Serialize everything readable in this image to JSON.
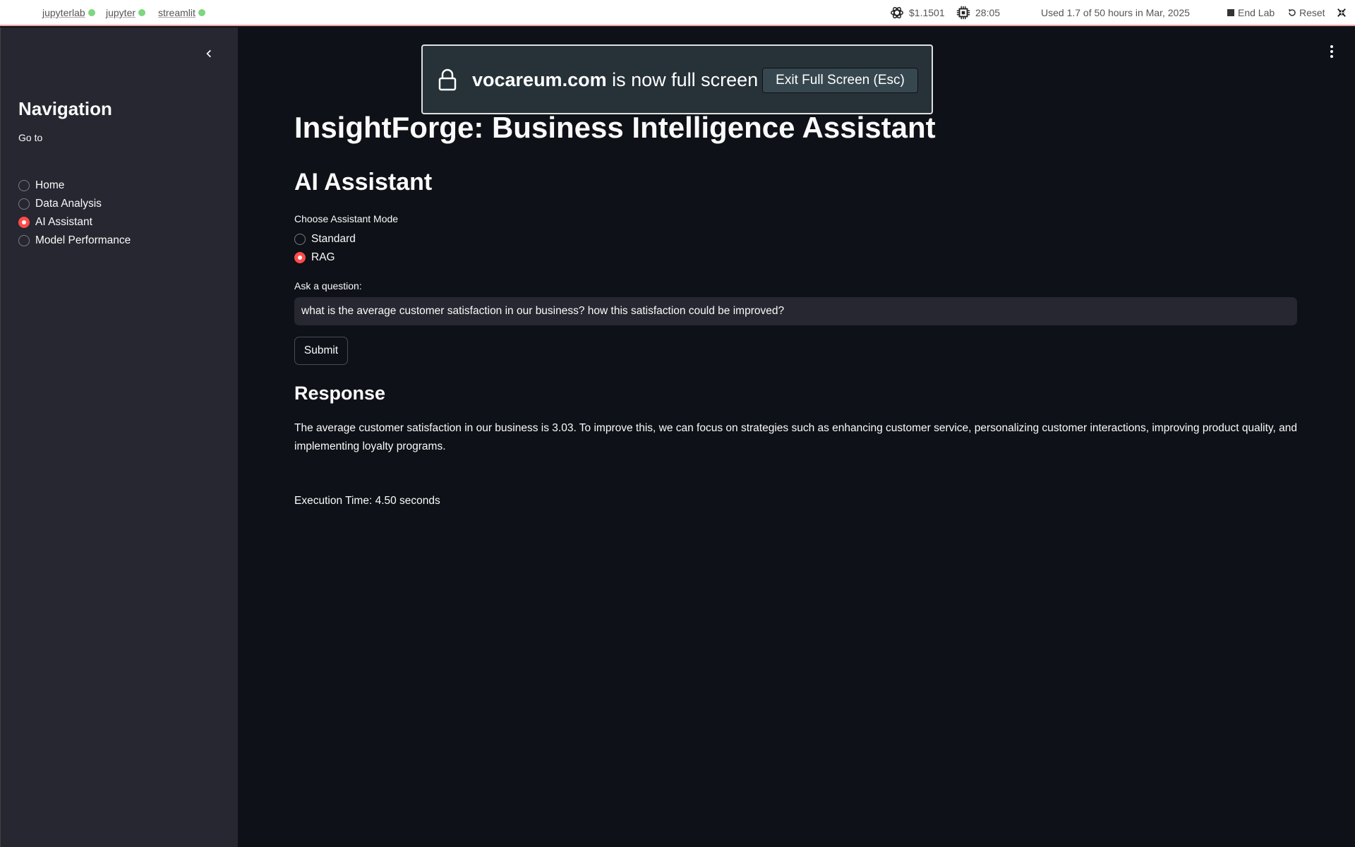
{
  "topbar": {
    "tabs": [
      "jupyterlab",
      "jupyter",
      "streamlit"
    ],
    "cost": "$1.1501",
    "time_remaining": "28:05",
    "usage": "Used 1.7 of 50 hours in Mar, 2025",
    "end_lab": "End Lab",
    "reset": "Reset",
    "icons": {
      "cost": "openai-icon",
      "time": "cpu-chip-icon",
      "end_lab": "stop-square-icon",
      "reset": "reset-icon",
      "fullscreen": "collapse-arrows-icon"
    },
    "status_dot_color": "#7ed67e"
  },
  "sidebar": {
    "title": "Navigation",
    "goto_label": "Go to",
    "items": [
      {
        "label": "Home",
        "selected": false
      },
      {
        "label": "Data Analysis",
        "selected": false
      },
      {
        "label": "AI Assistant",
        "selected": true
      },
      {
        "label": "Model Performance",
        "selected": false
      }
    ]
  },
  "main": {
    "title": "InsightForge: Business Intelligence Assistant",
    "section_title": "AI Assistant",
    "mode_label": "Choose Assistant Mode",
    "modes": [
      {
        "label": "Standard",
        "selected": false
      },
      {
        "label": "RAG",
        "selected": true
      }
    ],
    "question_label": "Ask a question:",
    "question_value": "what is the average customer satisfaction in our business? how this satisfaction could be improved?",
    "submit_label": "Submit",
    "response_title": "Response",
    "response_text": "The average customer satisfaction in our business is 3.03. To improve this, we can focus on strategies such as enhancing customer service, personalizing customer interactions, improving product quality, and implementing loyalty programs.",
    "execution_time": "Execution Time: 4.50 seconds"
  },
  "fullscreen_notice": {
    "domain": "vocareum.com",
    "message": " is now full screen",
    "exit_label": "Exit Full Screen (Esc)"
  },
  "colors": {
    "accent": "#ff4b4b",
    "background": "#0e1117",
    "sidebar": "#262730"
  }
}
